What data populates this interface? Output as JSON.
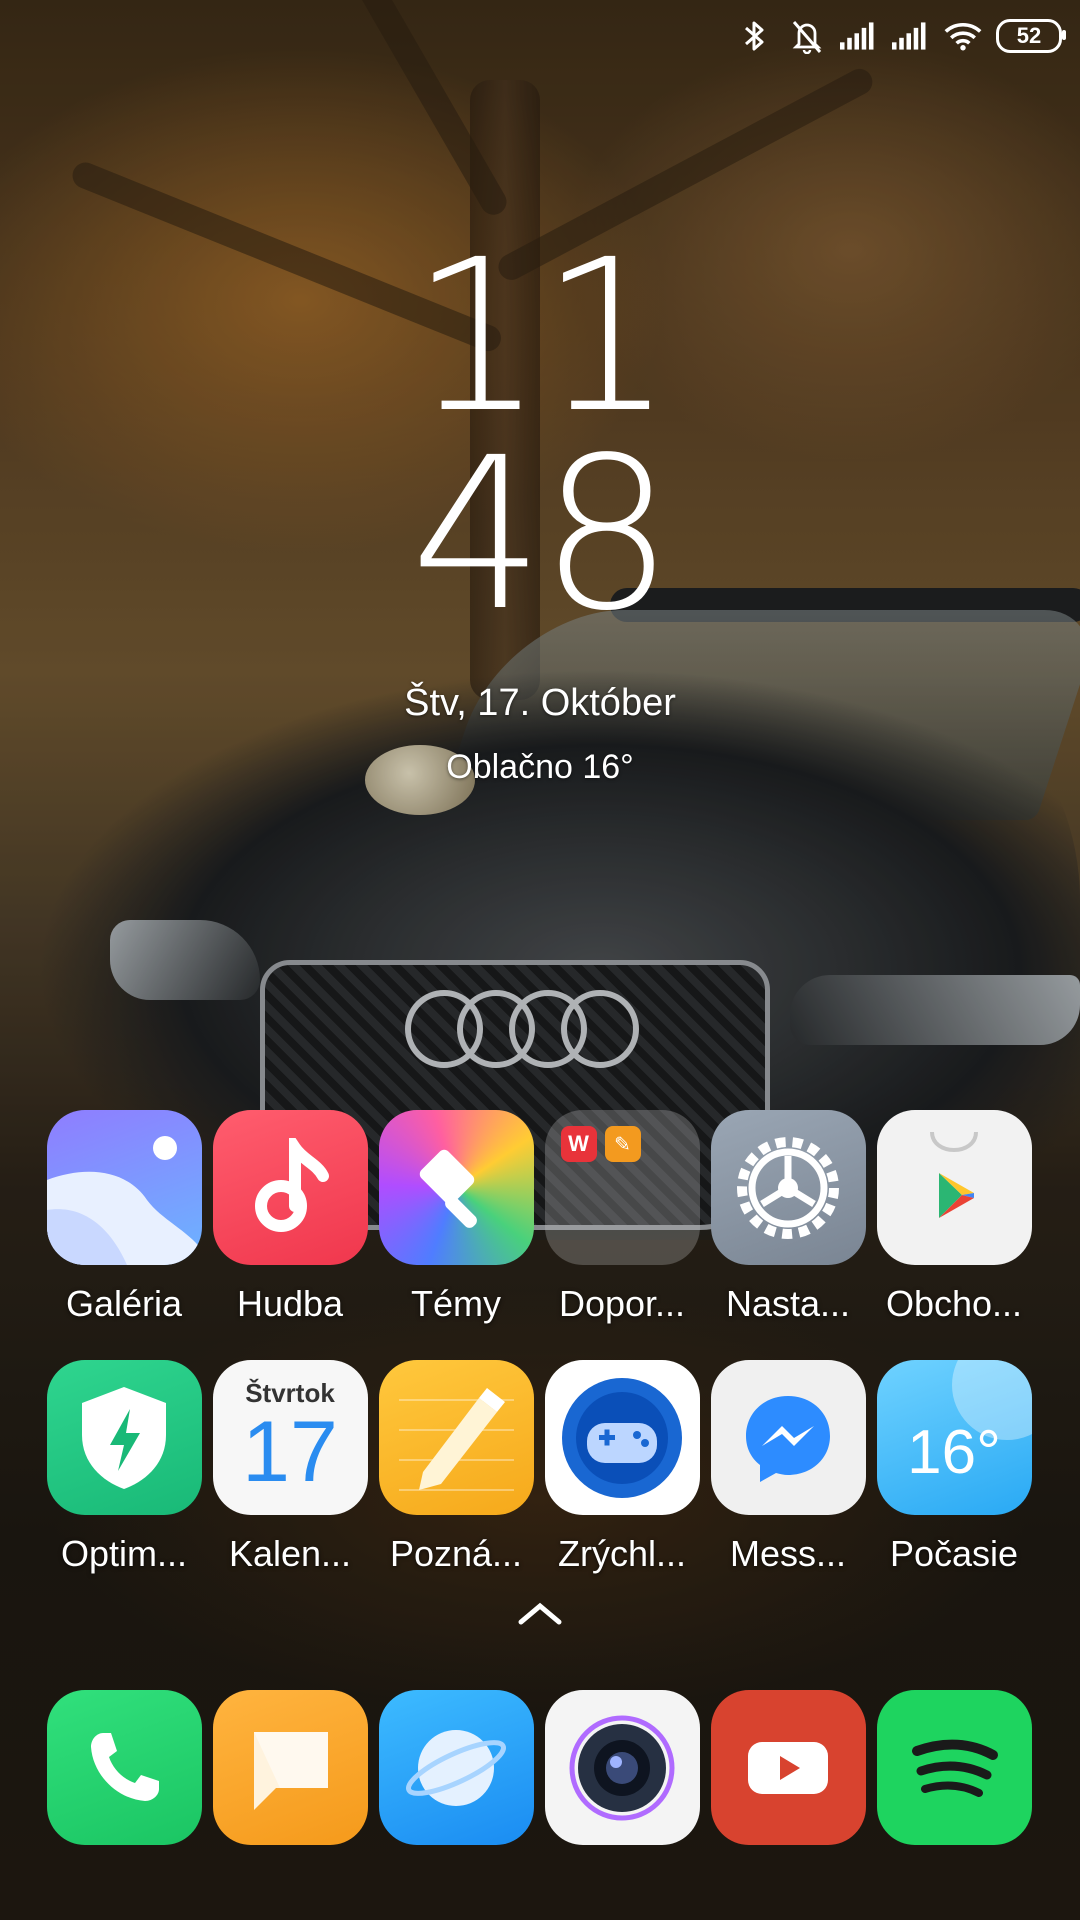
{
  "status_bar": {
    "icons": [
      "bluetooth-icon",
      "silent-bell-icon",
      "signal-1-icon",
      "signal-2-icon",
      "wifi-icon",
      "battery-icon"
    ],
    "battery": "52"
  },
  "lock": {
    "hour": "11",
    "minute": "48",
    "date": "Štv, 17. Október",
    "weather": "Oblačno  16°"
  },
  "apps_row1": [
    {
      "label": "Galéria",
      "icon": "gallery-icon"
    },
    {
      "label": "Hudba",
      "icon": "music-icon"
    },
    {
      "label": "Témy",
      "icon": "themes-icon"
    },
    {
      "label": "Dopor...",
      "icon": "folder-icon"
    },
    {
      "label": "Nasta...",
      "icon": "settings-icon"
    },
    {
      "label": "Obcho...",
      "icon": "play-store-icon"
    }
  ],
  "apps_row2": [
    {
      "label": "Optim...",
      "icon": "security-icon"
    },
    {
      "label": "Kalen...",
      "icon": "calendar-icon",
      "day_name": "Štvrtok",
      "day": "17"
    },
    {
      "label": "Pozná...",
      "icon": "notes-icon"
    },
    {
      "label": "Zrýchl...",
      "icon": "game-turbo-icon"
    },
    {
      "label": "Mess...",
      "icon": "messenger-icon"
    },
    {
      "label": "Počasie",
      "icon": "weather-icon",
      "temp": "16°"
    }
  ],
  "dock": [
    "phone-icon",
    "messages-icon",
    "browser-icon",
    "camera-icon",
    "youtube-icon",
    "spotify-icon"
  ]
}
